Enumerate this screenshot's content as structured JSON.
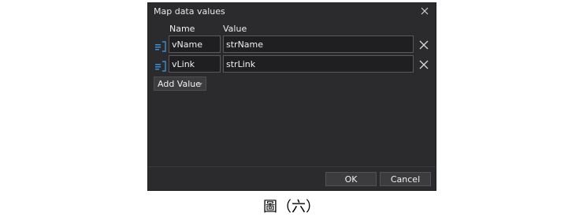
{
  "dialog": {
    "title": "Map data values",
    "headers": {
      "name": "Name",
      "value": "Value"
    },
    "rows": [
      {
        "name": "vName",
        "value": "strName"
      },
      {
        "name": "vLink",
        "value": "strLink"
      }
    ],
    "add_label": "Add Value",
    "ok_label": "OK",
    "cancel_label": "Cancel"
  },
  "caption": "圖（六）",
  "colors": {
    "dialog_bg": "#2b2b2d",
    "field_bg": "#1f1f21",
    "icon_blue": "#3a8fd8"
  }
}
